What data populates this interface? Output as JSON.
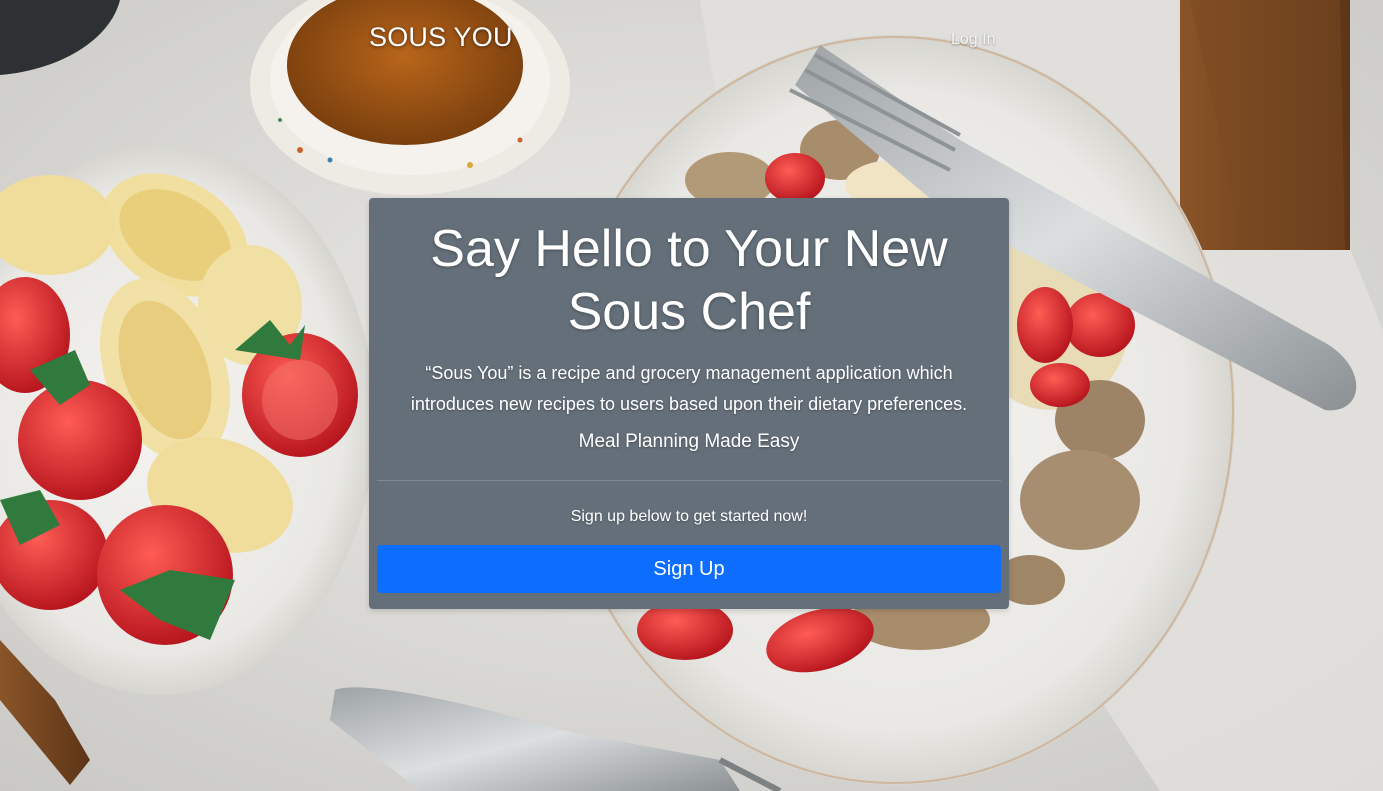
{
  "nav": {
    "brand": "SOUS YOU",
    "login_label": "Log In"
  },
  "hero": {
    "title": "Say Hello to Your New Sous Chef",
    "description": "“Sous You” is a recipe and grocery management application which introduces new recipes to users based upon their dietary preferences.",
    "tagline": "Meal Planning Made Easy",
    "cta_text": "Sign up below to get started now!",
    "signup_label": "Sign Up"
  },
  "colors": {
    "card_background": "#646f79",
    "primary_button": "#0d6efd",
    "text": "#ffffff"
  }
}
